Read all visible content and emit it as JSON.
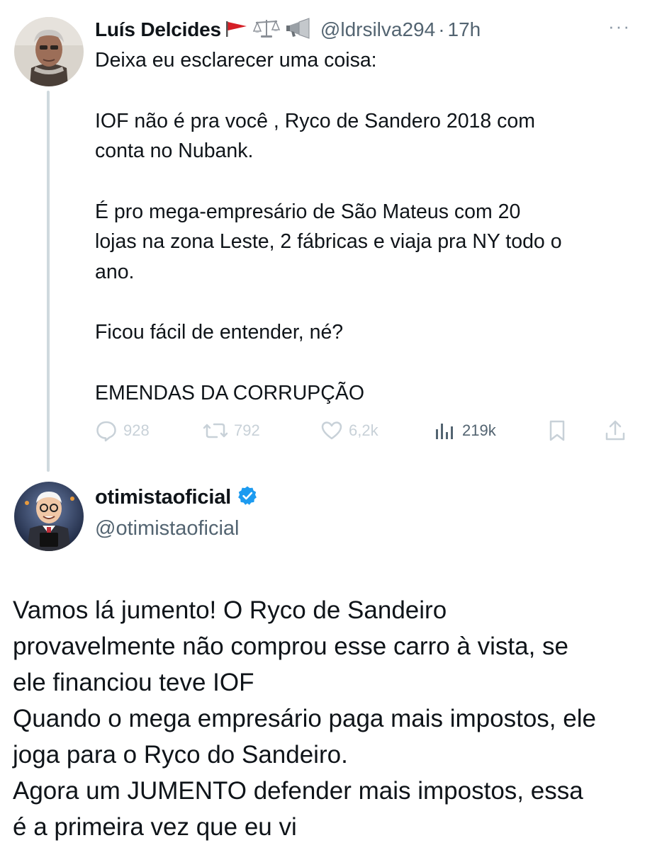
{
  "tweet1": {
    "author_name": "Luís Delcides",
    "emoji_icons": [
      "red-flag-icon",
      "balance-scale-icon",
      "megaphone-icon"
    ],
    "handle": "@ldrsilva294",
    "separator": "·",
    "time": "17h",
    "more_label": "···",
    "lines": [
      "Deixa eu esclarecer uma coisa:",
      "",
      "IOF não é pra você , Ryco de Sandero 2018 com",
      "conta no Nubank.",
      "",
      "É pro mega-empresário de São Mateus com 20",
      "lojas na zona Leste, 2 fábricas e viaja pra NY todo o",
      "ano.",
      "",
      "Ficou fácil de entender, né?",
      "",
      "EMENDAS DA CORRUPÇÃO"
    ],
    "actions": {
      "replies": "928",
      "reposts": "792",
      "likes": "6,2k",
      "views": "219k"
    }
  },
  "tweet2": {
    "author_name": "otimistaoficial",
    "verified_icon": "verified-badge-icon",
    "handle": "@otimistaoficial",
    "lines": [
      "Vamos lá jumento! O Ryco de Sandeiro",
      "provavelmente não comprou esse carro à vista, se",
      "ele financiou teve IOF",
      "Quando o mega empresário paga mais impostos, ele",
      "joga para o Ryco do Sandeiro.",
      "Agora um JUMENTO defender mais impostos, essa",
      "é a primeira vez que eu vi"
    ]
  },
  "colors": {
    "text": "#0f1419",
    "secondary": "#536471",
    "faded_action": "#c8d1d8",
    "verified": "#1d9bf0",
    "thread_line": "#cfd9de"
  }
}
